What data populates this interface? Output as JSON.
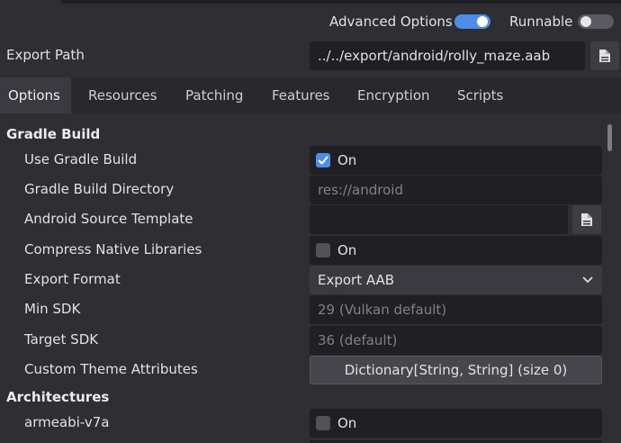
{
  "header": {
    "advanced_options_label": "Advanced Options",
    "advanced_options_on": true,
    "runnable_label": "Runnable",
    "runnable_on": false
  },
  "export_path": {
    "label": "Export Path",
    "value": "../../export/android/rolly_maze.aab",
    "browse_icon": "file-icon"
  },
  "tabs": [
    {
      "label": "Options",
      "active": true
    },
    {
      "label": "Resources",
      "active": false
    },
    {
      "label": "Patching",
      "active": false
    },
    {
      "label": "Features",
      "active": false
    },
    {
      "label": "Encryption",
      "active": false
    },
    {
      "label": "Scripts",
      "active": false
    }
  ],
  "gradle_build": {
    "section_title": "Gradle Build",
    "use_gradle_build": {
      "label": "Use Gradle Build",
      "checked": true,
      "value_text": "On"
    },
    "gradle_build_directory": {
      "label": "Gradle Build Directory",
      "placeholder": "res://android"
    },
    "android_source_template": {
      "label": "Android Source Template",
      "value": "",
      "browse_icon": "file-icon"
    },
    "compress_native_libraries": {
      "label": "Compress Native Libraries",
      "checked": false,
      "value_text": "On"
    },
    "export_format": {
      "label": "Export Format",
      "selected": "Export AAB"
    },
    "min_sdk": {
      "label": "Min SDK",
      "placeholder": "29 (Vulkan default)"
    },
    "target_sdk": {
      "label": "Target SDK",
      "placeholder": "36 (default)"
    },
    "custom_theme_attributes": {
      "label": "Custom Theme Attributes",
      "button_text": "Dictionary[String, String]  (size 0)"
    }
  },
  "architectures": {
    "section_title": "Architectures",
    "armeabi_v7a": {
      "label": "armeabi-v7a",
      "checked": false,
      "value_text": "On"
    }
  },
  "colors": {
    "accent": "#4c8ee8",
    "background": "#2e2e33",
    "field_bg": "#202024"
  }
}
